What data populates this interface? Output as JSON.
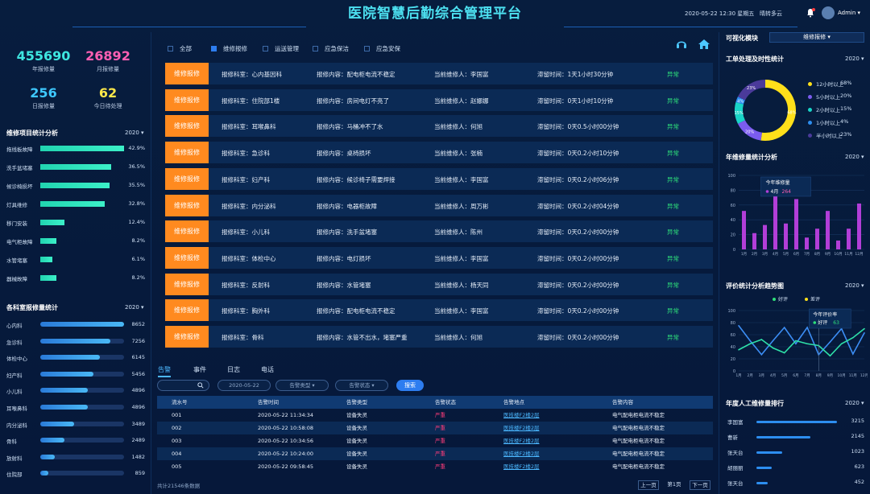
{
  "header": {
    "title": "医院智慧后勤综合管理平台",
    "datetime": "2020-05-22  12:30  星期五",
    "weather": "晴转多云",
    "user": "Admin"
  },
  "kpis": [
    {
      "value": "455690",
      "label": "年报修量",
      "color": "#3ee6e0"
    },
    {
      "value": "26892",
      "label": "月报修量",
      "color": "#ff5fb3"
    },
    {
      "value": "256",
      "label": "日报修量",
      "color": "#3ec8ff"
    },
    {
      "value": "62",
      "label": "今日待处理",
      "color": "#ffe84a"
    }
  ],
  "repair_items": {
    "title": "维修项目统计分析",
    "year": "2020",
    "items": [
      {
        "label": "拖线板故障",
        "pct": 42.9,
        "pct_text": "42.9%"
      },
      {
        "label": "洗手盆堵塞",
        "pct": 36.5,
        "pct_text": "36.5%"
      },
      {
        "label": "候诊椅损坏",
        "pct": 35.5,
        "pct_text": "35.5%"
      },
      {
        "label": "灯具维修",
        "pct": 32.8,
        "pct_text": "32.8%"
      },
      {
        "label": "移门安装",
        "pct": 12.4,
        "pct_text": "12.4%"
      },
      {
        "label": "电气柜故障",
        "pct": 8.2,
        "pct_text": "8.2%"
      },
      {
        "label": "水管堵塞",
        "pct": 6.1,
        "pct_text": "6.1%"
      },
      {
        "label": "器械故障",
        "pct": 8.2,
        "pct_text": "8.2%"
      }
    ]
  },
  "dept_stats": {
    "title": "各科室报修量统计",
    "year": "2020",
    "items": [
      {
        "label": "心内科",
        "value": 8652
      },
      {
        "label": "急诊科",
        "value": 7256
      },
      {
        "label": "体检中心",
        "value": 6145
      },
      {
        "label": "妇产科",
        "value": 5456
      },
      {
        "label": "小儿科",
        "value": 4896
      },
      {
        "label": "耳喉鼻科",
        "value": 4896
      },
      {
        "label": "内分泌科",
        "value": 3489
      },
      {
        "label": "骨科",
        "value": 2489
      },
      {
        "label": "放射科",
        "value": 1482
      },
      {
        "label": "住院部",
        "value": 859
      }
    ]
  },
  "filters": [
    "全部",
    "维修报修",
    "运送管理",
    "应急保洁",
    "应急安保"
  ],
  "active_filter": 1,
  "orders": [
    {
      "tag": "维修报修",
      "dept": "报修科室：心内基因科",
      "content": "报修内容：配电柜电流不稳定",
      "repairer": "当前维修人：李国富",
      "time": "滞留时间：1天1小时30分钟",
      "status": "异常"
    },
    {
      "tag": "维修报修",
      "dept": "报修科室：住院部1楼",
      "content": "报修内容：房间电灯不亮了",
      "repairer": "当前维修人：赵娜娜",
      "time": "滞留时间：0天1小时10分钟",
      "status": "异常"
    },
    {
      "tag": "维修报修",
      "dept": "报修科室：耳喉鼻科",
      "content": "报修内容：马桶冲不了水",
      "repairer": "当前维修人：何旭",
      "time": "滞留时间：0天0.5小时00分钟",
      "status": "异常"
    },
    {
      "tag": "维修报修",
      "dept": "报修科室：急诊科",
      "content": "报修内容：桌椅损坏",
      "repairer": "当前维修人：张楠",
      "time": "滞留时间：0天0.2小时10分钟",
      "status": "异常"
    },
    {
      "tag": "维修报修",
      "dept": "报修科室：妇产科",
      "content": "报修内容：候诊椅子需要焊接",
      "repairer": "当前维修人：李国富",
      "time": "滞留时间：0天0.2小时06分钟",
      "status": "异常"
    },
    {
      "tag": "维修报修",
      "dept": "报修科室：内分泌科",
      "content": "报修内容：电器柜故障",
      "repairer": "当前维修人：周万彬",
      "time": "滞留时间：0天0.2小时04分钟",
      "status": "异常"
    },
    {
      "tag": "维修报修",
      "dept": "报修科室：小儿科",
      "content": "报修内容：洗手盆堵塞",
      "repairer": "当前维修人：陈州",
      "time": "滞留时间：0天0.2小时00分钟",
      "status": "异常"
    },
    {
      "tag": "维修报修",
      "dept": "报修科室：体检中心",
      "content": "报修内容：电灯损坏",
      "repairer": "当前维修人：李国富",
      "time": "滞留时间：0天0.2小时00分钟",
      "status": "异常"
    },
    {
      "tag": "维修报修",
      "dept": "报修科室：反射科",
      "content": "报修内容：水管堵塞",
      "repairer": "当前维修人：杨天同",
      "time": "滞留时间：0天0.2小时00分钟",
      "status": "异常"
    },
    {
      "tag": "维修报修",
      "dept": "报修科室：胸外科",
      "content": "报修内容：配电柜电流不稳定",
      "repairer": "当前维修人：李国富",
      "time": "滞留时间：0天0.2小时00分钟",
      "status": "异常"
    },
    {
      "tag": "维修报修",
      "dept": "报修科室：骨科",
      "content": "报修内容：水管不出水，堵塞严重",
      "repairer": "当前维修人：何旭",
      "time": "滞留时间：0天0.2小时00分钟",
      "status": "异常"
    }
  ],
  "alarm_tabs": [
    "告警",
    "事件",
    "日志",
    "电话"
  ],
  "alarm_search": {
    "date": "2020-05-22",
    "type": "告警类型",
    "status": "告警状态",
    "button": "搜索"
  },
  "alarm_table": {
    "headers": [
      "流水号",
      "告警时间",
      "告警类型",
      "告警状态",
      "告警地点",
      "告警内容"
    ],
    "rows": [
      [
        "001",
        "2020-05-22    11:34:34",
        "设备失灵",
        "严重",
        "医技楼F2楼2层",
        "电气配电柜电流不稳定"
      ],
      [
        "002",
        "2020-05-22    10:58:08",
        "设备失灵",
        "严重",
        "医技楼F2楼2层",
        "电气配电柜电流不稳定"
      ],
      [
        "003",
        "2020-05-22    10:34:56",
        "设备失灵",
        "严重",
        "医技楼F2楼2层",
        "电气配电柜电流不稳定"
      ],
      [
        "004",
        "2020-05-22    10:24:00",
        "设备失灵",
        "严重",
        "医技楼F2楼2层",
        "电气配电柜电流不稳定"
      ],
      [
        "005",
        "2020-05-22    09:58:45",
        "设备失灵",
        "严重",
        "医技楼F2楼2层",
        "电气配电柜电流不稳定"
      ]
    ],
    "total": "共计21546条数据",
    "prev": "上一页",
    "page": "第1页",
    "next": "下一页"
  },
  "right": {
    "module_label": "可视化模块",
    "module_select": "维修报修",
    "donut_title": "工单处理及时性统计",
    "donut_year": "2020",
    "donut": [
      {
        "label": "12小时以上",
        "pct": "68%",
        "value": 68,
        "color": "#ffe01a"
      },
      {
        "label": "5小时以上",
        "pct": "20%",
        "value": 20,
        "color": "#7b5cf0"
      },
      {
        "label": "2小时以上",
        "pct": "15%",
        "value": 15,
        "color": "#19d4c8"
      },
      {
        "label": "1小时以上",
        "pct": "4%",
        "value": 4,
        "color": "#2d8ef0"
      },
      {
        "label": "半小时以上",
        "pct": "23%",
        "value": 23,
        "color": "#4a3a9a"
      }
    ],
    "annual_title": "年维修量统计分析",
    "annual_year": "2020",
    "tooltip_title": "今年维修量",
    "tooltip_label": "4月",
    "tooltip_value": "264",
    "eval_title": "评价统计分析趋势图",
    "eval_year": "2020",
    "eval_legend": [
      "好评",
      "差评"
    ],
    "eval_tooltip_title": "今年评价率",
    "eval_tooltip_label": "好评",
    "eval_tooltip_value": "63",
    "rank_title": "年度人工维修量排行",
    "rank_year": "2020",
    "ranks": [
      {
        "label": "李国富",
        "value": 3215
      },
      {
        "label": "曹新",
        "value": 2145
      },
      {
        "label": "张天台",
        "value": 1023
      },
      {
        "label": "胡丽丽",
        "value": 623
      },
      {
        "label": "张天台",
        "value": 452
      }
    ]
  },
  "chart_data": [
    {
      "type": "bar",
      "title": "年维修量统计分析",
      "categories": [
        "1月",
        "2月",
        "3月",
        "4月",
        "5月",
        "6月",
        "7月",
        "8月",
        "9月",
        "10月",
        "11月",
        "12月"
      ],
      "values": [
        52,
        22,
        33,
        85,
        35,
        68,
        16,
        28,
        52,
        12,
        28,
        62
      ],
      "ylim": [
        0,
        100
      ],
      "yticks": [
        0,
        20,
        40,
        60,
        80,
        100
      ]
    },
    {
      "type": "line",
      "title": "评价统计分析趋势图",
      "x": [
        "1月",
        "2月",
        "3月",
        "4月",
        "5月",
        "6月",
        "7月",
        "8月",
        "9月",
        "10月",
        "11月",
        "12月"
      ],
      "series": [
        {
          "name": "好评",
          "color": "#3c8ef5",
          "values": [
            75,
            50,
            27,
            50,
            72,
            45,
            72,
            27,
            48,
            70,
            28,
            63
          ]
        },
        {
          "name": "差评",
          "color": "#2ee0a8",
          "values": [
            35,
            45,
            52,
            38,
            30,
            50,
            45,
            42,
            25,
            45,
            55,
            70
          ]
        }
      ],
      "ylim": [
        0,
        100
      ],
      "yticks": [
        0,
        20,
        40,
        60,
        80,
        100
      ]
    }
  ]
}
